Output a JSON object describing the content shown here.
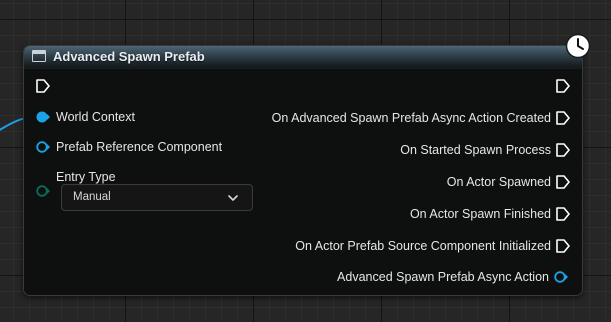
{
  "node": {
    "title": "Advanced Spawn Prefab",
    "header_icon": "function-icon",
    "badge_icon": "clock-icon"
  },
  "inputs": {
    "exec": {
      "icon": "exec-pin-icon"
    },
    "world_context": {
      "label": "World Context",
      "icon": "object-pin-connected-icon"
    },
    "prefab_reference_component": {
      "label": "Prefab Reference Component",
      "icon": "object-pin-icon"
    },
    "entry_type": {
      "label": "Entry Type",
      "icon": "enum-pin-icon",
      "selected": "Manual"
    }
  },
  "outputs": {
    "exec": {
      "icon": "exec-pin-icon"
    },
    "items": [
      {
        "label": "On Advanced Spawn Prefab Async Action Created",
        "icon": "exec-pin-icon"
      },
      {
        "label": "On Started Spawn Process",
        "icon": "exec-pin-icon"
      },
      {
        "label": "On Actor Spawned",
        "icon": "exec-pin-icon"
      },
      {
        "label": "On Actor Spawn Finished",
        "icon": "exec-pin-icon"
      },
      {
        "label": "On Actor Prefab Source Component Initialized",
        "icon": "exec-pin-icon"
      }
    ],
    "return_value": {
      "label": "Advanced Spawn Prefab Async Action",
      "icon": "object-pin-icon"
    }
  },
  "colors": {
    "object_pin": "#1aa3e8",
    "enum_pin": "#0a5c4e",
    "exec_pin": "#ffffff",
    "header_top": "#4d6673",
    "node_body": "#0e0f0f",
    "graph_background": "#262626"
  }
}
